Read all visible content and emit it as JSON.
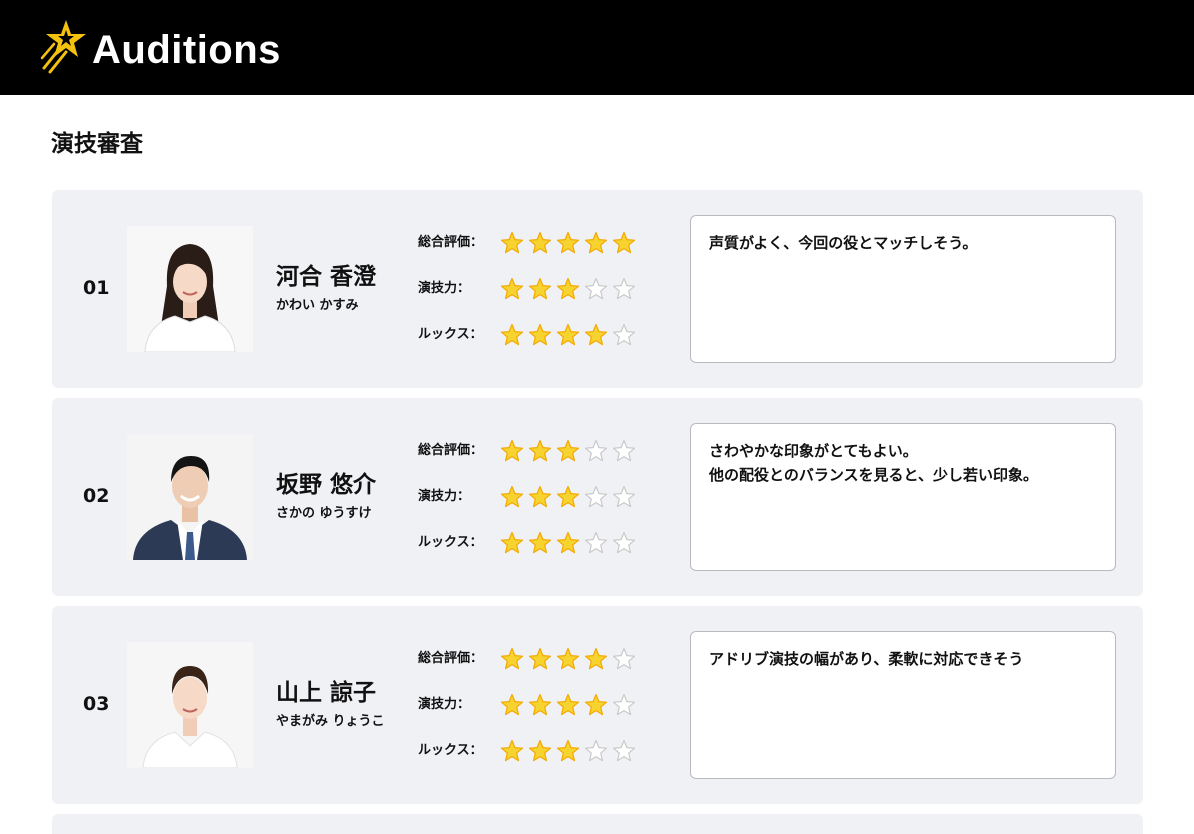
{
  "header": {
    "title": "Auditions",
    "logo": "star-pencil-logo"
  },
  "section": {
    "title": "演技審査"
  },
  "labels": {
    "overall": "総合評価：",
    "acting": "演技力：",
    "looks": "ルックス："
  },
  "colors": {
    "header_bg": "#000000",
    "star_filled": "#f7d32f",
    "star_outline": "#f3a900",
    "star_empty": "#c9c9c9",
    "card_bg": "#f0f1f5"
  },
  "candidates": [
    {
      "number": "01",
      "name": "河合 香澄",
      "kana": "かわい かすみ",
      "photo": "female-long-hair-avatar",
      "ratings": {
        "overall": 5,
        "acting": 3,
        "looks": 4
      },
      "comment": "声質がよく、今回の役とマッチしそう。"
    },
    {
      "number": "02",
      "name": "坂野 悠介",
      "kana": "さかの ゆうすけ",
      "photo": "male-suit-avatar",
      "ratings": {
        "overall": 3,
        "acting": 3,
        "looks": 3
      },
      "comment": "さわやかな印象がとてもよい。\n他の配役とのバランスを見ると、少し若い印象。"
    },
    {
      "number": "03",
      "name": "山上 諒子",
      "kana": "やまがみ りょうこ",
      "photo": "female-bun-hair-avatar",
      "ratings": {
        "overall": 4,
        "acting": 4,
        "looks": 3
      },
      "comment": "アドリブ演技の幅があり、柔軟に対応できそう"
    }
  ],
  "max_stars": 5
}
